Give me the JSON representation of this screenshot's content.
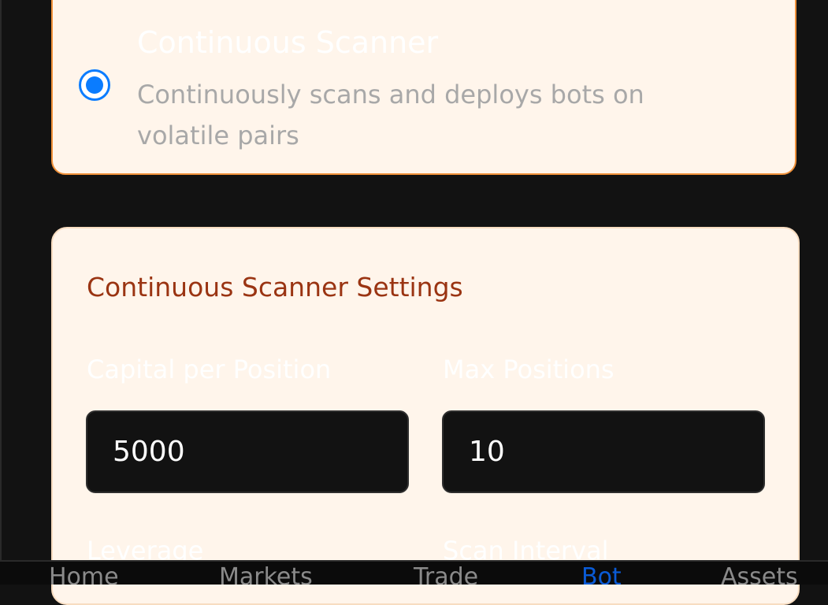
{
  "mode_option": {
    "title": "Continuous Scanner",
    "description": "Continuously scans and deploys bots on volatile pairs",
    "selected": true
  },
  "settings": {
    "title": "Continuous Scanner Settings",
    "capital_per_position": {
      "label": "Capital per Position",
      "value": "5000"
    },
    "max_positions": {
      "label": "Max Positions",
      "value": "10"
    },
    "leverage": {
      "label": "Leverage"
    },
    "scan_interval": {
      "label": "Scan Interval"
    }
  },
  "bottom_nav": {
    "items": [
      {
        "label": "Home"
      },
      {
        "label": "Markets"
      },
      {
        "label": "Trade"
      },
      {
        "label": "Bot"
      },
      {
        "label": "Assets"
      }
    ],
    "active": "Bot"
  },
  "colors": {
    "accent_blue": "#0a7cff",
    "card_background": "#fff5eb",
    "selected_border": "#f0913a",
    "settings_title": "#9a3412",
    "page_background": "#121212"
  }
}
